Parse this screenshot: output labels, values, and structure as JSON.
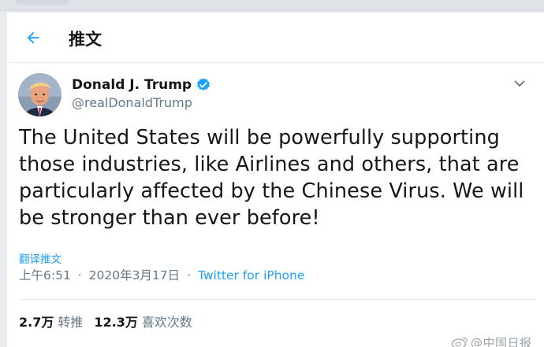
{
  "header": {
    "title": "推文",
    "back_icon": "arrow-left-icon"
  },
  "tweet": {
    "display_name": "Donald J. Trump",
    "handle": "@realDonaldTrump",
    "verified_icon": "verified-badge-icon",
    "text": "The United States will be powerfully supporting those industries, like Airlines and others, that are particularly affected by the Chinese Virus. We will be stronger than ever before!",
    "translate_label": "翻译推文",
    "time": "上午6:51",
    "separator": "·",
    "date": "2020年3月17日",
    "source": "Twitter for iPhone"
  },
  "stats": {
    "retweets": "2.7万",
    "retweets_label": "转推",
    "likes": "12.3万",
    "likes_label": "喜欢次数"
  },
  "watermark": {
    "text": "@中国日报"
  },
  "colors": {
    "accent": "#1da1f2",
    "secondary_text": "#657786",
    "primary_text": "#14171a"
  }
}
